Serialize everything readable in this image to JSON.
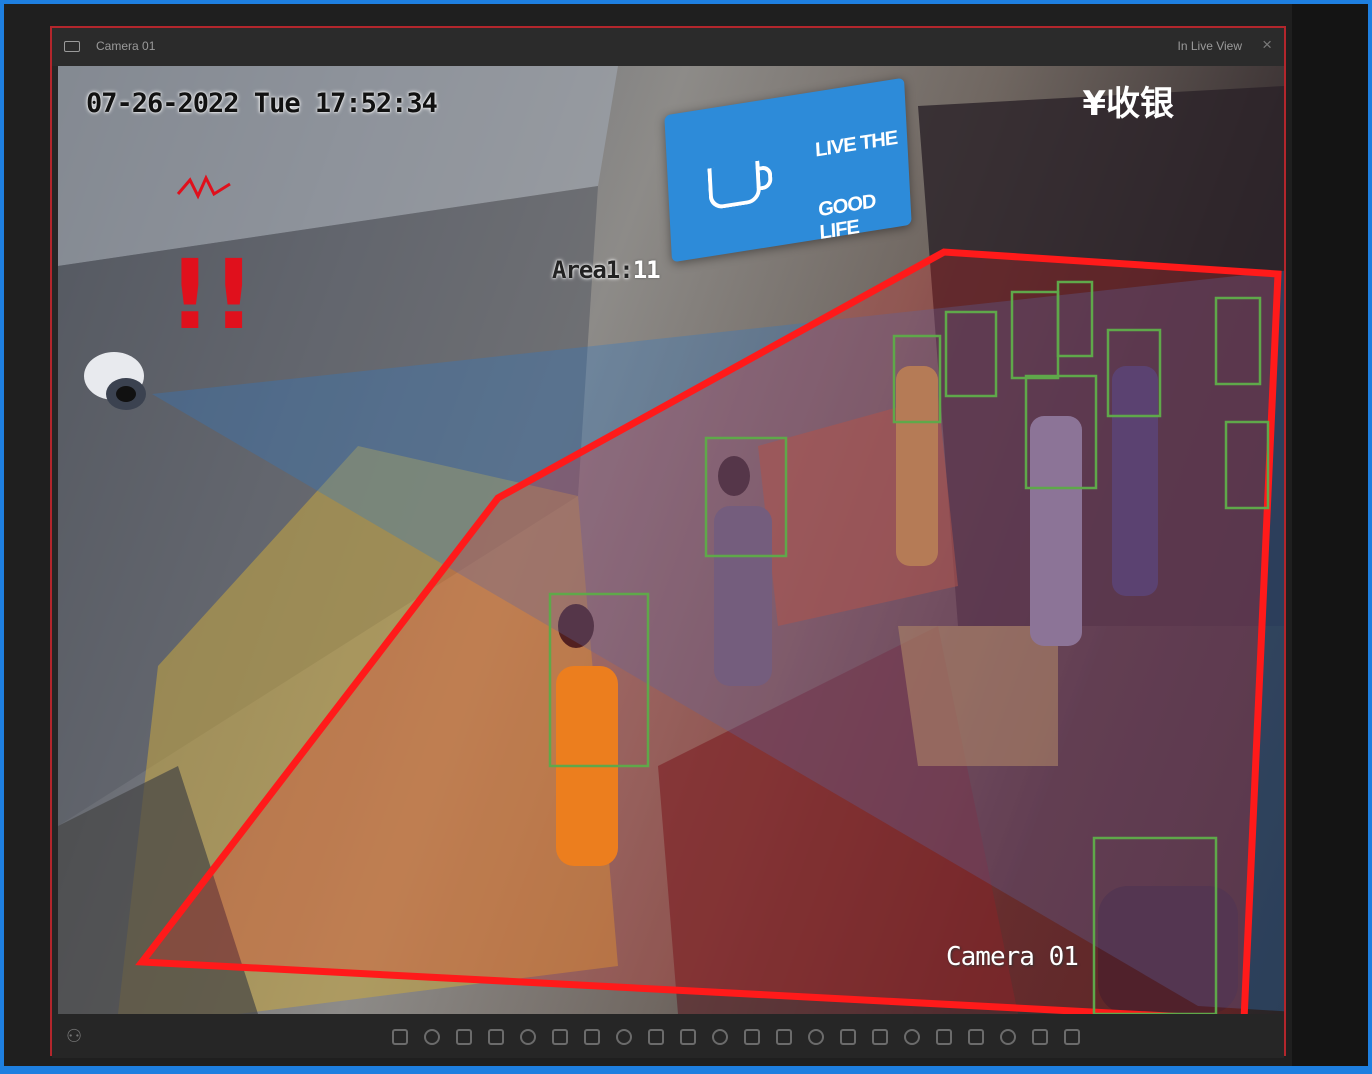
{
  "window": {
    "title": "Camera 01",
    "status": "In Live View",
    "close_glyph": "×"
  },
  "osd": {
    "timestamp": "07-26-2022 Tue 17:52:34",
    "area_label": "Area1:",
    "area_count": "11",
    "camera_label": "Camera 01"
  },
  "scene": {
    "sign_line1": "LIVE THE",
    "sign_line2": "GOOD LIFE",
    "cashier_sign": "¥收银",
    "alert_glyph": "!!"
  },
  "toolbar": {
    "icons": [
      "person-icon",
      "snapshot-icon",
      "record-icon",
      "audio-icon",
      "zoom-icon",
      "ptz-icon",
      "instant-playback-icon",
      "fisheye-icon",
      "layout-icon",
      "person-count-icon",
      "rotate-icon",
      "camera-switch-icon",
      "mic-icon",
      "stream-icon",
      "window-icon",
      "split-icon",
      "settings-icon",
      "light-icon",
      "export-icon",
      "image-icon",
      "capture-icon",
      "bookmark-icon",
      "exit-icon"
    ]
  },
  "colors": {
    "border_blue": "#1e7fe0",
    "window_border": "#b3262c",
    "zone_red": "#ff1a1a",
    "detect_green": "#5fa84a"
  }
}
